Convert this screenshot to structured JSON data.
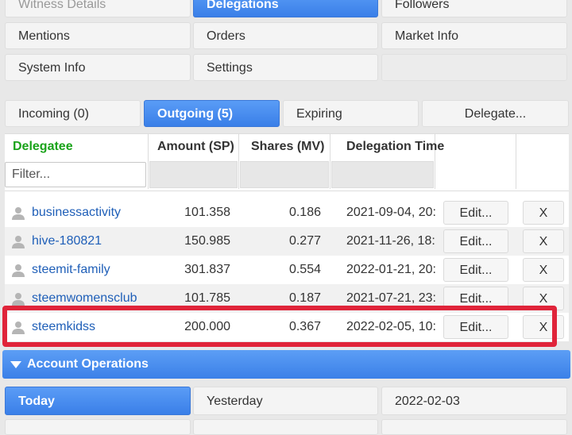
{
  "nav": {
    "witness_details": "Witness Details",
    "delegations": "Delegations",
    "followers": "Followers",
    "mentions": "Mentions",
    "orders": "Orders",
    "market_info": "Market Info",
    "system_info": "System Info",
    "settings": "Settings"
  },
  "tabs": {
    "incoming": "Incoming (0)",
    "outgoing": "Outgoing (5)",
    "expiring": "Expiring",
    "delegate": "Delegate..."
  },
  "table": {
    "headers": {
      "delegatee": "Delegatee",
      "amount": "Amount (SP)",
      "shares": "Shares (MV)",
      "time": "Delegation Time"
    },
    "filter_placeholder": "Filter...",
    "edit_label": "Edit...",
    "remove_label": "X",
    "rows": [
      {
        "user": "businessactivity",
        "amount": "101.358",
        "shares": "0.186",
        "time": "2021-09-04, 20:"
      },
      {
        "user": "hive-180821",
        "amount": "150.985",
        "shares": "0.277",
        "time": "2021-11-26, 18:"
      },
      {
        "user": "steemit-family",
        "amount": "301.837",
        "shares": "0.554",
        "time": "2022-01-21, 20:"
      },
      {
        "user": "steemwomensclub",
        "amount": "101.785",
        "shares": "0.187",
        "time": "2021-07-21, 23:"
      },
      {
        "user": "steemkidss",
        "amount": "200.000",
        "shares": "0.367",
        "time": "2022-02-05, 10:"
      }
    ]
  },
  "account_ops": {
    "title": "Account Operations",
    "today": "Today",
    "yesterday": "Yesterday",
    "date": "2022-02-03"
  },
  "colors": {
    "accent": "#3a7fe8",
    "delegatee_header": "#1aa31a",
    "highlight_box": "#e0243a",
    "link": "#1f5fb8"
  }
}
